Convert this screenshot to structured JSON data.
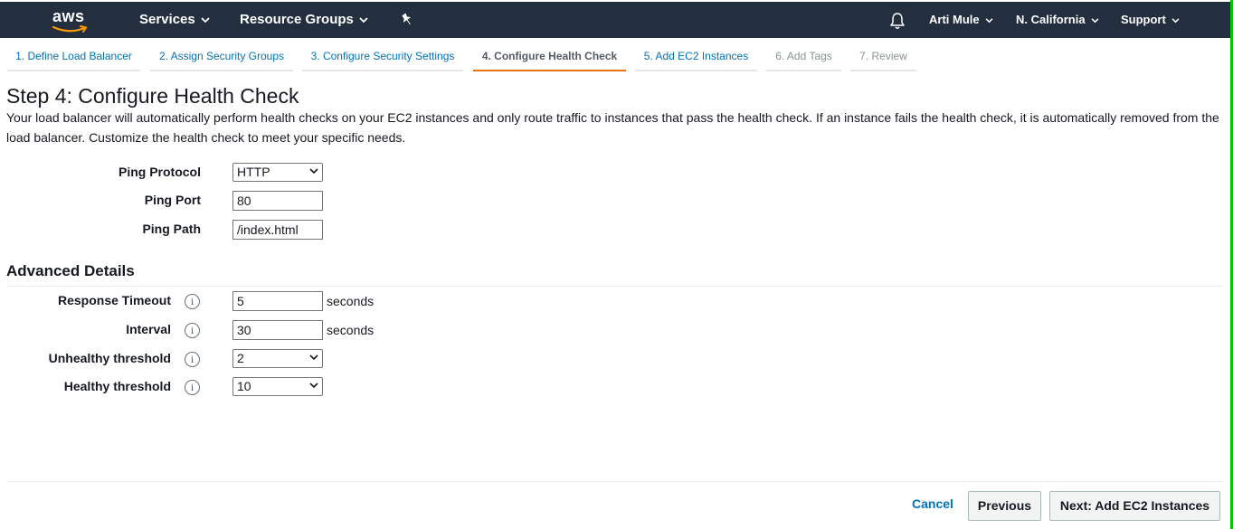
{
  "topnav": {
    "logo_text": "aws",
    "services": "Services",
    "resource_groups": "Resource Groups",
    "user": "Arti Mule",
    "region": "N. California",
    "support": "Support"
  },
  "tabs": [
    {
      "label": "1. Define Load Balancer",
      "state": "link"
    },
    {
      "label": "2. Assign Security Groups",
      "state": "link"
    },
    {
      "label": "3. Configure Security Settings",
      "state": "link"
    },
    {
      "label": "4. Configure Health Check",
      "state": "active"
    },
    {
      "label": "5. Add EC2 Instances",
      "state": "link"
    },
    {
      "label": "6. Add Tags",
      "state": "disabled"
    },
    {
      "label": "7. Review",
      "state": "disabled"
    }
  ],
  "page": {
    "title": "Step 4: Configure Health Check",
    "description": "Your load balancer will automatically perform health checks on your EC2 instances and only route traffic to instances that pass the health check. If an instance fails the health check, it is automatically removed from the load balancer. Customize the health check to meet your specific needs."
  },
  "health_check": {
    "ping_protocol_label": "Ping Protocol",
    "ping_protocol_value": "HTTP",
    "ping_port_label": "Ping Port",
    "ping_port_value": "80",
    "ping_path_label": "Ping Path",
    "ping_path_value": "/index.html"
  },
  "advanced": {
    "title": "Advanced Details",
    "response_timeout_label": "Response Timeout",
    "response_timeout_value": "5",
    "interval_label": "Interval",
    "interval_value": "30",
    "unit_seconds": "seconds",
    "unhealthy_label": "Unhealthy threshold",
    "unhealthy_value": "2",
    "healthy_label": "Healthy threshold",
    "healthy_value": "10",
    "info_glyph": "i"
  },
  "footer": {
    "cancel": "Cancel",
    "previous": "Previous",
    "next": "Next: Add EC2 Instances"
  },
  "colors": {
    "nav_bg": "#232f3e",
    "link": "#0073bb",
    "active_tab_underline": "#ec7211",
    "logo_smile": "#ff9900"
  },
  "icons": {
    "pin": "pin-icon",
    "bell": "bell-icon",
    "caret": "chevron-down-icon",
    "info": "info-icon"
  }
}
